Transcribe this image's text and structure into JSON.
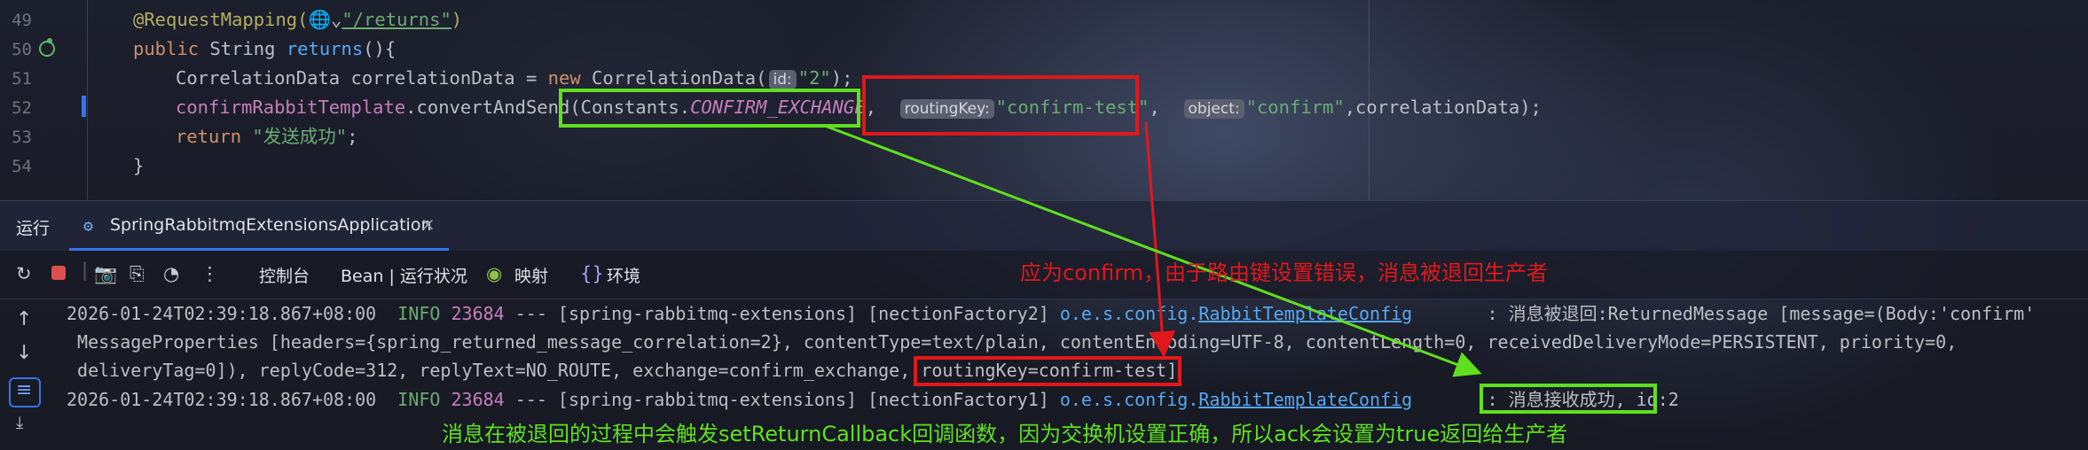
{
  "editor": {
    "lines": [
      {
        "num": "49"
      },
      {
        "num": "50"
      },
      {
        "num": "51"
      },
      {
        "num": "52"
      },
      {
        "num": "53"
      },
      {
        "num": "54"
      }
    ],
    "l49": {
      "anno": "@RequestMapping(",
      "globe": "🌐",
      "chev": "⌄",
      "path": "\"/returns\"",
      "close": ")"
    },
    "l50": {
      "pub": "public ",
      "type": "String ",
      "name": "returns",
      "rest": "(){"
    },
    "l51": {
      "cls": "CorrelationData correlationData = ",
      "new": "new ",
      "ctor": "CorrelationData(",
      "hint": "id:",
      "arg": "\"2\"",
      "end": ");"
    },
    "l52": {
      "field": "confirmRabbitTemplate",
      "dot": ".",
      "method": "convertAndSend",
      "paren": "(",
      "consts": "Constants.",
      "ex": "CONFIRM_EXCHANGE",
      "comma1": ",",
      "hint1": "routingKey:",
      "rk": "\"confirm-test\"",
      "comma2": ",",
      "hint2": "object:",
      "obj": "\"confirm\"",
      "tail": ",correlationData);"
    },
    "l53": {
      "ret": "return ",
      "msg": "\"发送成功\"",
      "semi": ";"
    },
    "l54": {
      "brace": "}"
    }
  },
  "run_panel": {
    "label": "运行",
    "tab_title": "SpringRabbitmqExtensionsApplication",
    "close": "×"
  },
  "toolbar": {
    "tabs": [
      "控制台",
      "Bean | 运行状况",
      "映射",
      "环境"
    ]
  },
  "console": {
    "line1": {
      "ts": "2026-01-24T02:39:18.867+08:00  ",
      "level": "INFO",
      "pid": " 23684",
      "mid": " --- [spring-rabbitmq-extensions] [nectionFactory2] ",
      "pkg": "o.e.s.config.",
      "cls": "RabbitTemplateConfig",
      "msg": "       : 消息被退回:ReturnedMessage [message=(Body:'confirm'"
    },
    "line2": " MessageProperties [headers={spring_returned_message_correlation=2}, contentType=text/plain, contentEncoding=UTF-8, contentLength=0, receivedDeliveryMode=PERSISTENT, priority=0,",
    "line3a": " deliveryTag=0]), replyCode=312, replyText=NO_ROUTE, exchange=confirm_exchange, ",
    "line3b": "routingKey=confirm-test]",
    "line4": {
      "ts": "2026-01-24T02:39:18.867+08:00  ",
      "level": "INFO",
      "pid": " 23684",
      "mid": " --- [spring-rabbitmq-extensions] [nectionFactory1] ",
      "pkg": "o.e.s.config.",
      "cls": "RabbitTemplateConfig",
      "gap": "       ",
      "msg": ": 消息接收成功, id:2"
    }
  },
  "annotations": {
    "red_note": "应为confirm，由于路由键设置错误，消息被退回生产者",
    "green_note": "消息在被退回的过程中会触发setReturnCallback回调函数，因为交换机设置正确，所以ack会设置为true返回给生产者",
    "colors": {
      "red": "#e0181b",
      "green": "#5fe01f"
    }
  }
}
